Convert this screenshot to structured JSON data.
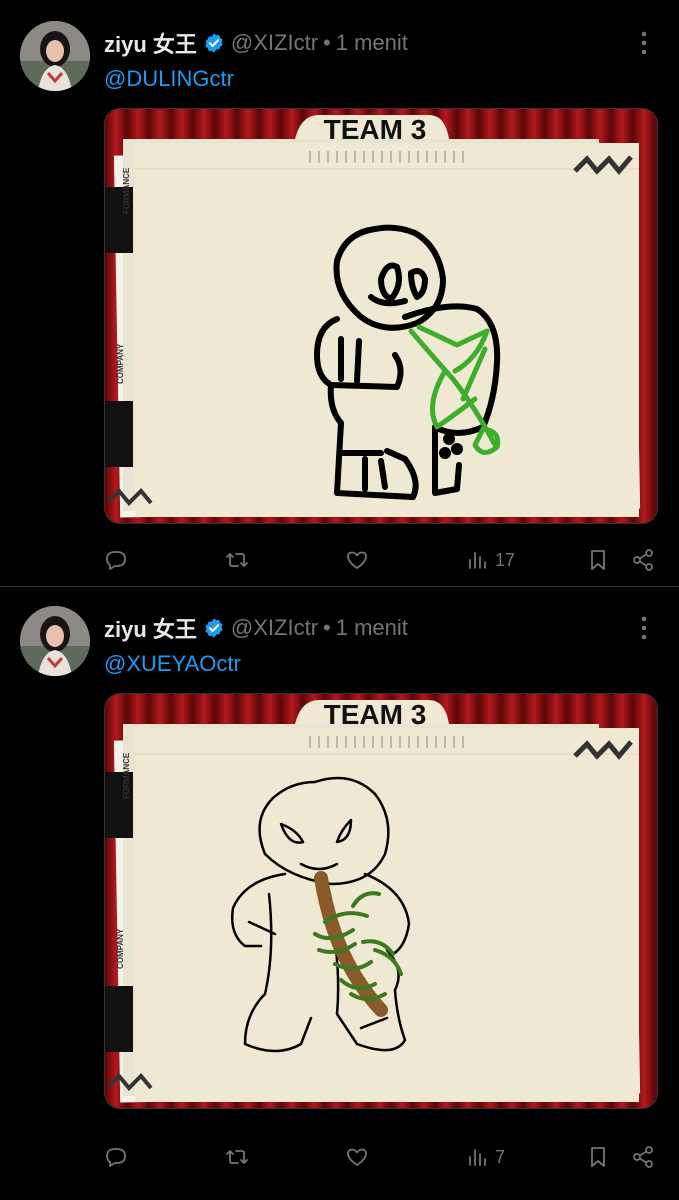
{
  "tweets": [
    {
      "author": {
        "name": "ziyu 女王",
        "handle": "@XIZIctr",
        "separator": "•",
        "time": "1 menit"
      },
      "mention": "@DULINGctr",
      "image": {
        "folder_tab_text": "TEAM 3",
        "side_label_1": "FORMANCE",
        "side_label_2": "COMPANY"
      },
      "stats": {
        "views": "17"
      }
    },
    {
      "author": {
        "name": "ziyu 女王",
        "handle": "@XIZIctr",
        "separator": "•",
        "time": "1 menit"
      },
      "mention": "@XUEYAOctr",
      "image": {
        "folder_tab_text": "TEAM 3",
        "side_label_1": "FORMANCE",
        "side_label_2": "COMPANY"
      },
      "stats": {
        "views": "7"
      }
    }
  ],
  "colors": {
    "background": "#000000",
    "text_primary": "#e7e9ea",
    "text_secondary": "#71767b",
    "link": "#1d9bf0",
    "verified": "#1d9bf0",
    "divider": "#2f3336",
    "curtain": "#7a0d10",
    "paper": "#efe8d2",
    "drawing_green": "#3dae2b",
    "drawing_brown": "#8b5a2b"
  }
}
